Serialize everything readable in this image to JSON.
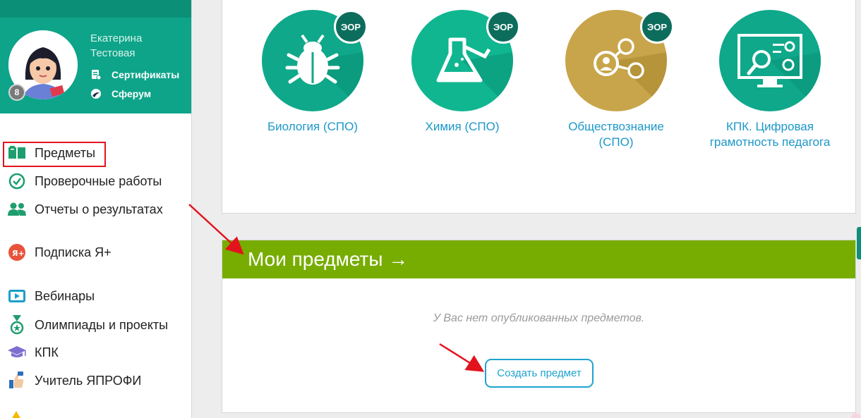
{
  "profile": {
    "first_name": "Екатерина",
    "last_name": "Тестовая",
    "badge": "8",
    "links": [
      {
        "label": "Сертификаты",
        "icon": "certificate-icon"
      },
      {
        "label": "Сферум",
        "icon": "sferum-icon"
      }
    ]
  },
  "menu": {
    "items": [
      {
        "label": "Предметы",
        "icon": "book-icon",
        "selected": true
      },
      {
        "label": "Проверочные работы",
        "icon": "check-circle-icon"
      },
      {
        "label": "Отчеты о результатах",
        "icon": "users-icon"
      },
      {
        "label": "Подписка Я+",
        "icon": "ya-plus-icon"
      },
      {
        "label": "Вебинары",
        "icon": "play-icon"
      },
      {
        "label": "Олимпиады и проекты",
        "icon": "medal-icon"
      },
      {
        "label": "КПК",
        "icon": "graduation-cap-icon"
      },
      {
        "label": "Учитель ЯПРОФИ",
        "icon": "thumbs-up-icon"
      }
    ]
  },
  "subjects": [
    {
      "label": "Биология (СПО)",
      "badge": "ЭОР",
      "icon": "bug-icon",
      "color": "#0fa88a"
    },
    {
      "label": "Химия (СПО)",
      "badge": "ЭОР",
      "icon": "flask-icon",
      "color": "#0fb690"
    },
    {
      "label": "Обществознание (СПО)",
      "badge": "ЭОР",
      "icon": "network-icon",
      "color": "#c8a54a"
    },
    {
      "label": "КПК. Цифровая грамотность педагога",
      "icon": "computer-settings-icon",
      "color": "#0fa88a"
    }
  ],
  "my_subjects": {
    "title": "Мои предметы →",
    "empty_text": "У Вас нет опубликованных предметов.",
    "create_button": "Создать предмет"
  },
  "colors": {
    "brand_teal": "#0ea48a",
    "header_green": "#77ad00",
    "link_blue": "#1c98c9",
    "highlight_red": "#e3131e"
  }
}
